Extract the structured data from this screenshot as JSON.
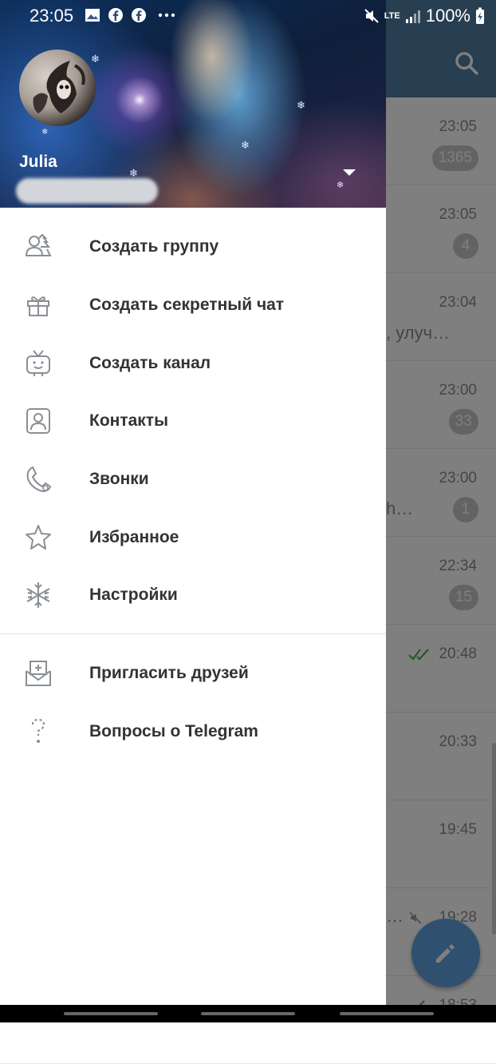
{
  "status_bar": {
    "time": "23:05",
    "network": "LTE",
    "battery": "100%"
  },
  "drawer": {
    "user_name": "Julia",
    "menu": [
      {
        "label": "Создать группу",
        "icon": "group-icon"
      },
      {
        "label": "Создать секретный чат",
        "icon": "gift-icon"
      },
      {
        "label": "Создать канал",
        "icon": "tv-icon"
      },
      {
        "label": "Контакты",
        "icon": "contacts-icon"
      },
      {
        "label": "Звонки",
        "icon": "phone-icon"
      },
      {
        "label": "Избранное",
        "icon": "star-icon"
      },
      {
        "label": "Настройки",
        "icon": "snowflake-icon"
      }
    ],
    "menu_secondary": [
      {
        "label": "Пригласить друзей",
        "icon": "invite-envelope-icon"
      },
      {
        "label": "Вопросы о Telegram",
        "icon": "question-icon"
      }
    ]
  },
  "chat_list": [
    {
      "time": "23:05",
      "badge": "1365",
      "preview": ""
    },
    {
      "time": "23:05",
      "badge": "4",
      "preview": ""
    },
    {
      "time": "23:04",
      "badge": "",
      "preview": ", улуч…"
    },
    {
      "time": "23:00",
      "badge": "33",
      "preview": ""
    },
    {
      "time": "23:00",
      "badge": "1",
      "preview": "h…"
    },
    {
      "time": "22:34",
      "badge": "15",
      "preview": ""
    },
    {
      "time": "20:48",
      "badge": "",
      "preview": ""
    },
    {
      "time": "20:33",
      "badge": "",
      "preview": ""
    },
    {
      "time": "19:45",
      "badge": "",
      "preview": ""
    },
    {
      "time": "19:28",
      "badge": "",
      "preview": "…"
    },
    {
      "time": "18:53",
      "badge": "",
      "preview": ""
    }
  ],
  "colors": {
    "header_blue": "#517da2",
    "fab_blue": "#5fa3de",
    "badge_grey": "#c7c7c7",
    "check_green": "#4caf50"
  }
}
